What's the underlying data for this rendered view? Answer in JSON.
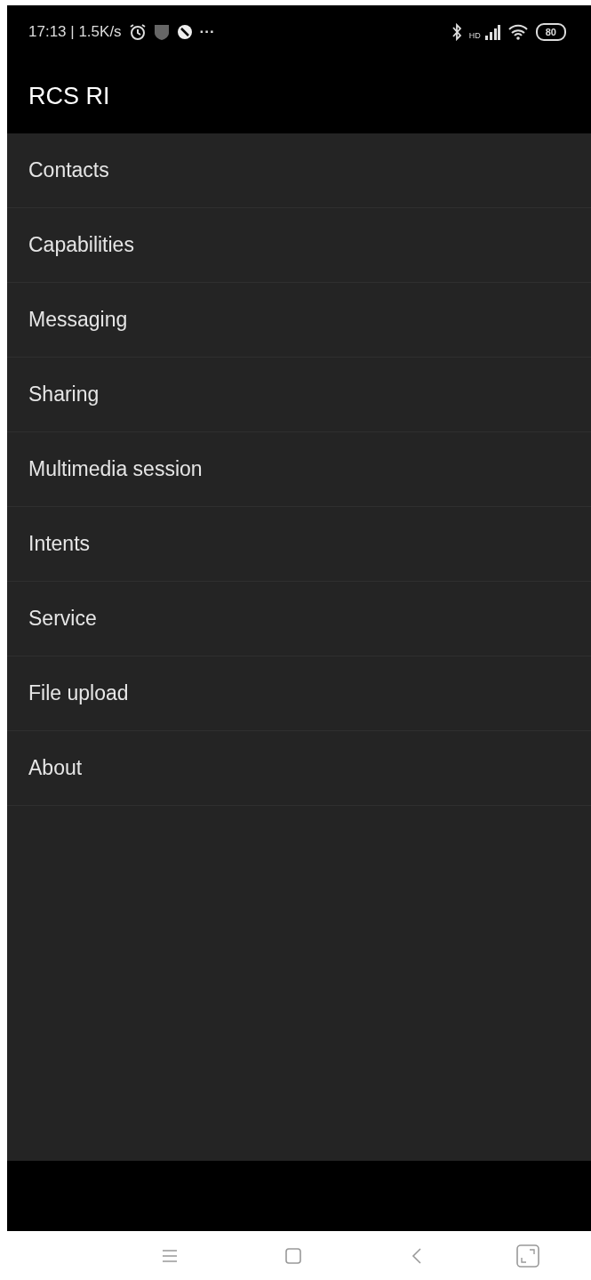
{
  "status_bar": {
    "time_speed": "17:13 | 1.5K/s",
    "more": "···",
    "network": "HD",
    "battery": "80"
  },
  "app_bar": {
    "title": "RCS RI"
  },
  "menu": [
    {
      "label": "Contacts"
    },
    {
      "label": "Capabilities"
    },
    {
      "label": "Messaging"
    },
    {
      "label": "Sharing"
    },
    {
      "label": "Multimedia session"
    },
    {
      "label": "Intents"
    },
    {
      "label": "Service"
    },
    {
      "label": "File upload"
    },
    {
      "label": "About"
    }
  ]
}
